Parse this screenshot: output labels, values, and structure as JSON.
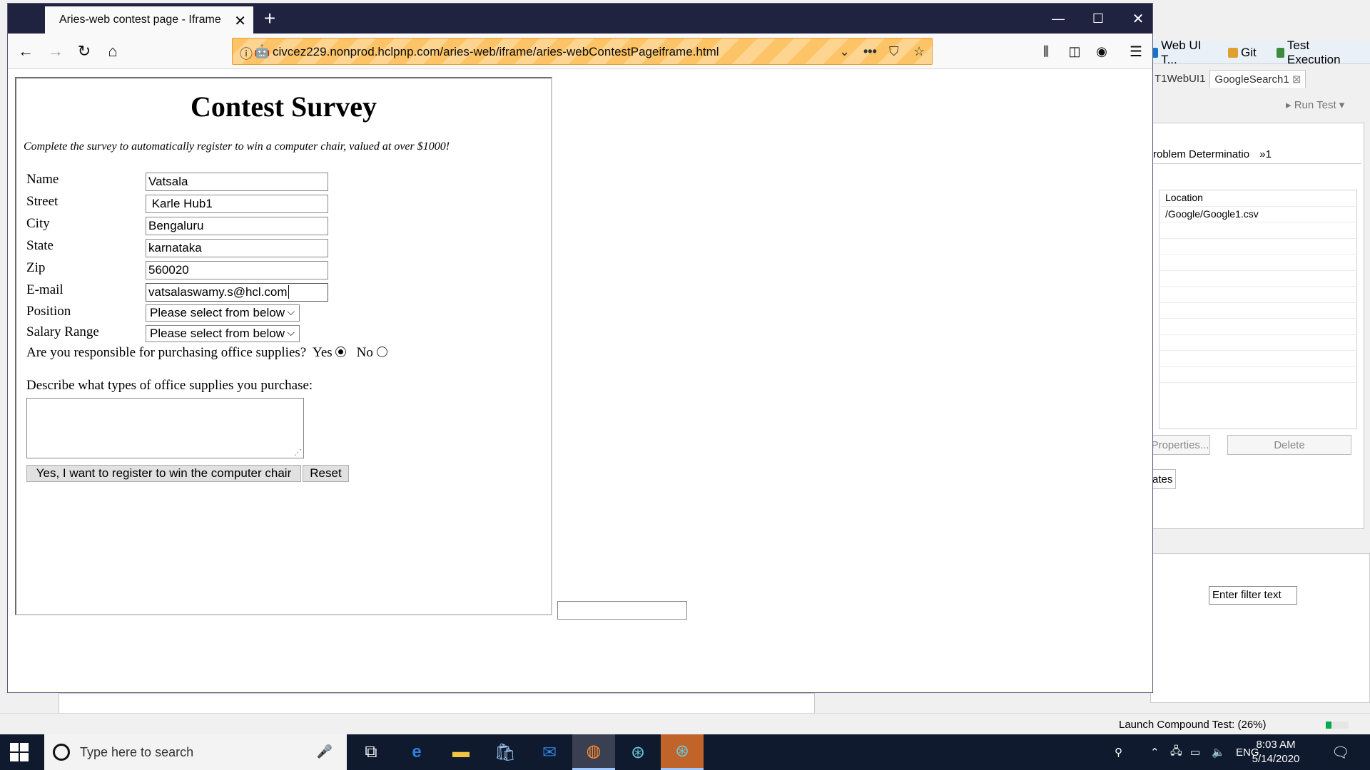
{
  "ide": {
    "toolbar_items": [
      "Web UI T...",
      "Git",
      "Test Execution"
    ],
    "tabs": [
      "T1WebUI1",
      "GoogleSearch1"
    ],
    "run_test_label": "Run Test",
    "panel_tab": "roblem Determinatio",
    "panel_tab_overflow": "»1",
    "table_header": "Location",
    "table_rows": [
      "/Google/Google1.csv"
    ],
    "properties_button": "Properties...",
    "delete_button": "Delete",
    "lower_button": "ates",
    "filter_placeholder": "Enter filter text",
    "status_text": "Launch Compound Test: (26%)",
    "progress": 0.26
  },
  "browser": {
    "tab_title": "Aries-web contest page - Iframe",
    "url": "civcez229.nonprod.hclpnp.com/aries-web/iframe/aries-webContestPageiframe.html"
  },
  "survey": {
    "title": "Contest Survey",
    "subtitle": "Complete the survey to automatically register to win a computer chair, valued at over $1000!",
    "fields": {
      "name": {
        "label": "Name",
        "value": "Vatsala"
      },
      "street": {
        "label": "Street",
        "value": " Karle Hub1"
      },
      "city": {
        "label": "City",
        "value": "Bengaluru"
      },
      "state": {
        "label": "State",
        "value": "karnataka"
      },
      "zip": {
        "label": "Zip",
        "value": "560020"
      },
      "email": {
        "label": "E-mail",
        "value": "vatsalaswamy.s@hcl.com"
      }
    },
    "position": {
      "label": "Position",
      "selected": "Please select from below"
    },
    "salary": {
      "label": "Salary Range",
      "selected": "Please select from below"
    },
    "purchasing_question": "Are you responsible for purchasing office supplies?",
    "yes_label": "Yes",
    "no_label": "No",
    "yes_checked": true,
    "describe_label": "Describe what types of office supplies you purchase:",
    "describe_value": "",
    "submit_label": "Yes, I want to register to win the computer chair",
    "reset_label": "Reset"
  },
  "taskbar": {
    "search_placeholder": "Type here to search",
    "language": "ENG",
    "time": "8:03 AM",
    "date": "5/14/2020"
  }
}
